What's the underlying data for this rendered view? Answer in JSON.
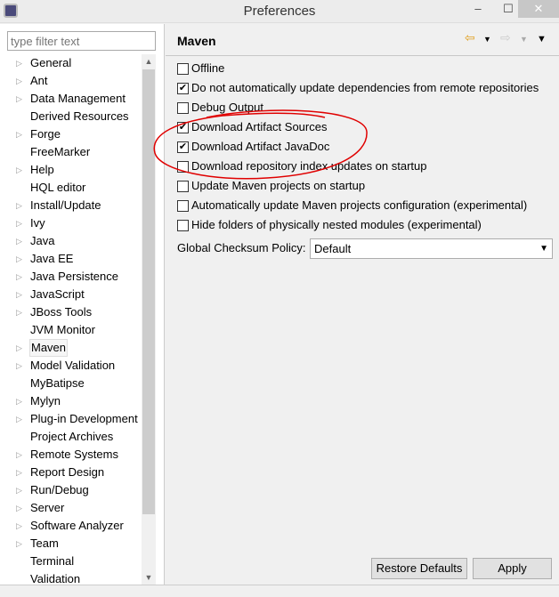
{
  "window": {
    "title": "Preferences",
    "minimize": "–",
    "maximize": "☐",
    "close": "✕"
  },
  "filter": {
    "placeholder": "type filter text"
  },
  "tree": [
    {
      "label": "General",
      "expandable": true
    },
    {
      "label": "Ant",
      "expandable": true
    },
    {
      "label": "Data Management",
      "expandable": true
    },
    {
      "label": "Derived Resources",
      "expandable": false
    },
    {
      "label": "Forge",
      "expandable": true
    },
    {
      "label": "FreeMarker",
      "expandable": false
    },
    {
      "label": "Help",
      "expandable": true
    },
    {
      "label": "HQL editor",
      "expandable": false
    },
    {
      "label": "Install/Update",
      "expandable": true
    },
    {
      "label": "Ivy",
      "expandable": true
    },
    {
      "label": "Java",
      "expandable": true
    },
    {
      "label": "Java EE",
      "expandable": true
    },
    {
      "label": "Java Persistence",
      "expandable": true
    },
    {
      "label": "JavaScript",
      "expandable": true
    },
    {
      "label": "JBoss Tools",
      "expandable": true
    },
    {
      "label": "JVM Monitor",
      "expandable": false
    },
    {
      "label": "Maven",
      "expandable": true,
      "selected": true
    },
    {
      "label": "Model Validation",
      "expandable": true
    },
    {
      "label": "MyBatipse",
      "expandable": false
    },
    {
      "label": "Mylyn",
      "expandable": true
    },
    {
      "label": "Plug-in Development",
      "expandable": true
    },
    {
      "label": "Project Archives",
      "expandable": false
    },
    {
      "label": "Remote Systems",
      "expandable": true
    },
    {
      "label": "Report Design",
      "expandable": true
    },
    {
      "label": "Run/Debug",
      "expandable": true
    },
    {
      "label": "Server",
      "expandable": true
    },
    {
      "label": "Software Analyzer",
      "expandable": true
    },
    {
      "label": "Team",
      "expandable": true
    },
    {
      "label": "Terminal",
      "expandable": false
    },
    {
      "label": "Validation",
      "expandable": false
    }
  ],
  "page": {
    "title": "Maven",
    "options": [
      {
        "label": "Offline",
        "checked": false
      },
      {
        "label": "Do not automatically update dependencies from remote repositories",
        "checked": true
      },
      {
        "label": "Debug Output",
        "checked": false
      },
      {
        "label": "Download Artifact Sources",
        "checked": true
      },
      {
        "label": "Download Artifact JavaDoc",
        "checked": true
      },
      {
        "label": "Download repository index updates on startup",
        "checked": false
      },
      {
        "label": "Update Maven projects on startup",
        "checked": false
      },
      {
        "label": "Automatically update Maven projects configuration (experimental)",
        "checked": false
      },
      {
        "label": "Hide folders of physically nested modules (experimental)",
        "checked": false
      }
    ],
    "checksum_label": "Global Checksum Policy:",
    "checksum_value": "Default",
    "restore_defaults": "Restore Defaults",
    "apply": "Apply"
  },
  "annotation_color": "#e00000"
}
